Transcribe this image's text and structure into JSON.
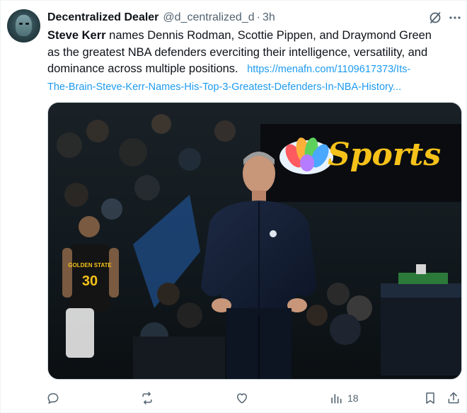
{
  "author": {
    "display_name": "Decentralized Dealer",
    "handle": "@d_centralized_d",
    "separator": "·",
    "time": "3h"
  },
  "tweet": {
    "text_bold": "Steve Kerr",
    "text_line_1": "names Dennis Rodman, Scottie Pippen, and Draymond Green",
    "text_line_2": "as the greatest NBA defenders everciting their intelligence, versatility, and",
    "text_line_3": "dominance across multiple positions.",
    "link_part_1": "https://menafn.com/1109617373/Its-",
    "link_part_2": "The-Brain-Steve-Kerr-Names-His-Top-3-Greatest-Defenders-In-NBA-History..."
  },
  "media": {
    "sign_text": "Sports",
    "jersey_team": "GOLDEN STATE",
    "jersey_number": "30"
  },
  "actions": {
    "views_count": "18"
  },
  "colors": {
    "link": "#1d9bf0",
    "secondary_text": "#536471",
    "sign_gold": "#f6c21a"
  },
  "icons": [
    "grok-icon",
    "more-icon",
    "reply-icon",
    "retweet-icon",
    "like-icon",
    "views-icon",
    "bookmark-icon",
    "share-icon"
  ]
}
